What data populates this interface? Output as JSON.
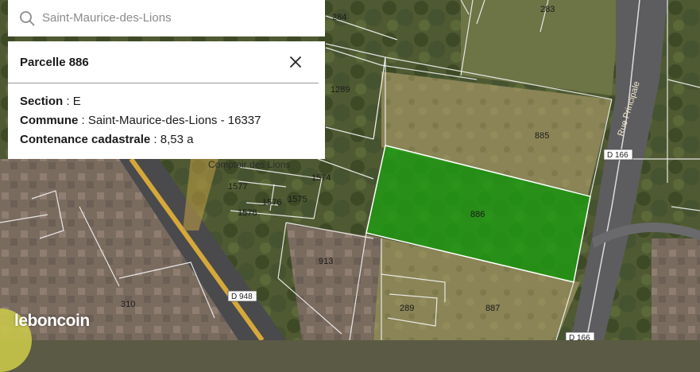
{
  "search": {
    "placeholder": "Saint-Maurice-des-Lions"
  },
  "panel": {
    "title": "Parcelle 886",
    "rows": [
      {
        "key": "Section",
        "value": " : E"
      },
      {
        "key": "Commune",
        "value": " : Saint-Maurice-des-Lions - 16337"
      },
      {
        "key": "Contenance cadastrale",
        "value": " : 8,53 a"
      }
    ]
  },
  "map": {
    "selected_parcel": "886",
    "selected_color": "#1e9e12",
    "parcels": [
      "284",
      "283",
      "1289",
      "885",
      "886",
      "1574",
      "1577",
      "1576",
      "1575",
      "1578",
      "913",
      "289",
      "887",
      "310"
    ],
    "roads": [
      "D 166",
      "D 948",
      "D 166"
    ],
    "street_name": "Rue Principale",
    "place_name": "Comptoir des Lions"
  },
  "brand": {
    "logo_text": "leboncoin"
  },
  "icons": {
    "search": "search-icon",
    "close": "close-icon",
    "locate": "locate-button"
  }
}
